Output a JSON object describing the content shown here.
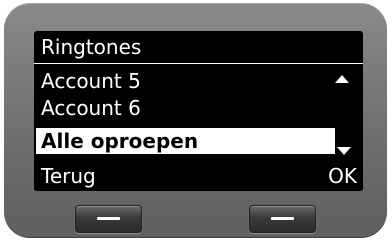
{
  "screen": {
    "title": "Ringtones",
    "items": [
      {
        "label": "Account 5",
        "selected": false
      },
      {
        "label": "Account 6",
        "selected": false
      },
      {
        "label": "Alle oproepen",
        "selected": true
      }
    ],
    "scroll_up_icon": "triangle-up-icon",
    "scroll_down_icon": "triangle-down-icon"
  },
  "softkeys": {
    "left_label": "Terug",
    "right_label": "OK"
  },
  "colors": {
    "screen_background": "#000000",
    "text": "#ffffff",
    "selection_background": "#ffffff",
    "selection_text": "#000000",
    "device_body": "#7a7a7a"
  }
}
